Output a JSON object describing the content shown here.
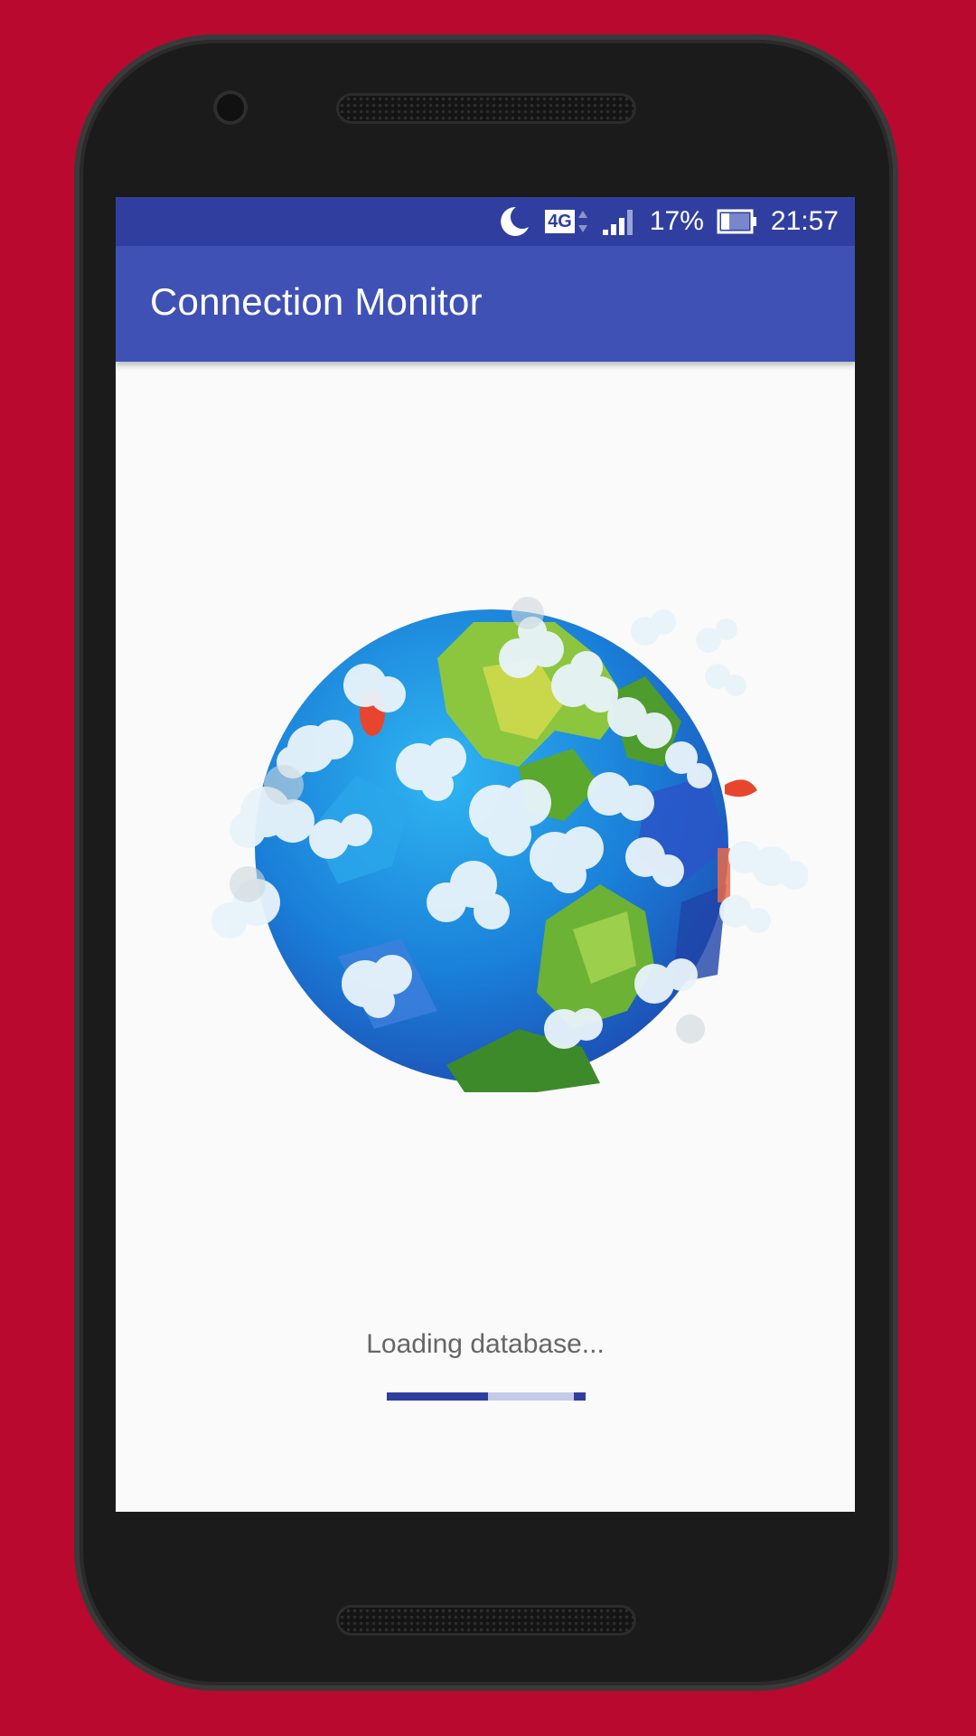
{
  "status_bar": {
    "network": "4G",
    "battery_percent": "17%",
    "time": "21:57",
    "icons": [
      "moon-icon",
      "network-4g-icon",
      "signal-icon",
      "battery-icon"
    ]
  },
  "app_bar": {
    "title": "Connection Monitor"
  },
  "content": {
    "illustration": "low-poly-earth-globe",
    "loading_text": "Loading database...",
    "progress": {
      "primary_fraction": 0.51,
      "secondary_fraction": 0.06
    }
  },
  "colors": {
    "background": "#b9092f",
    "status_bar": "#303f9f",
    "app_bar": "#3f51b5",
    "progress_track": "#c5cae9",
    "progress_fill": "#303f9f"
  }
}
